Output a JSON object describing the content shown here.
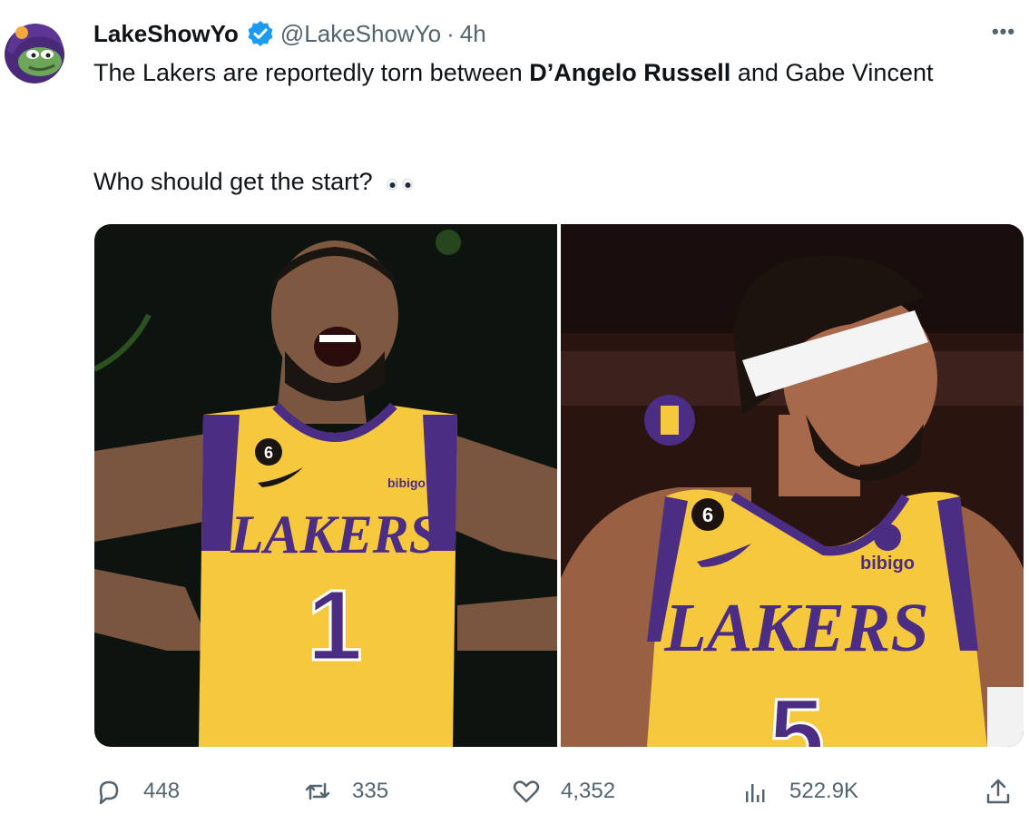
{
  "author": {
    "display_name": "LakeShowYo",
    "handle": "@LakeShowYo",
    "separator": "·",
    "time": "4h",
    "verified_icon": "verified-badge-icon",
    "avatar_icon": "pepe-frog-avatar"
  },
  "more_label": "•••",
  "tweet": {
    "text_part1": "The Lakers are reportedly torn between ",
    "text_bold": "D’Angelo Russell",
    "text_part2": " and Gabe Vincent",
    "question": "Who should get the start?"
  },
  "media": {
    "left": {
      "jersey_team": "LAKERS",
      "jersey_number": "1",
      "patch": "6",
      "sponsor": "bibigo"
    },
    "right": {
      "jersey_team": "LAKERS",
      "jersey_number": "5",
      "patch": "6",
      "sponsor": "bibigo"
    }
  },
  "actions": {
    "replies": "448",
    "retweets": "335",
    "likes": "4,352",
    "views": "522.9K"
  },
  "colors": {
    "lakers_gold": "#f6c83e",
    "lakers_purple": "#4b2d84",
    "verified_blue": "#1d9bf0",
    "muted_text": "#536471"
  }
}
